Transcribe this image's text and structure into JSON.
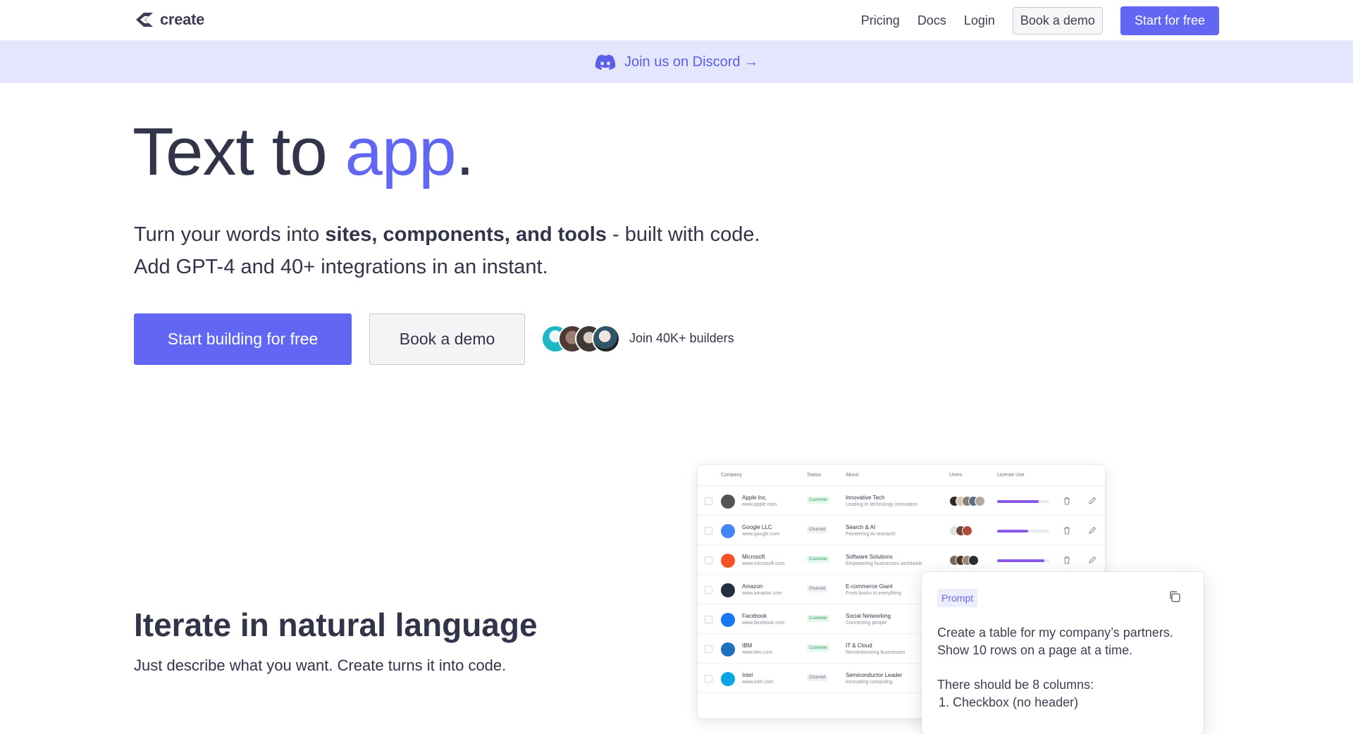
{
  "nav": {
    "logo_text": "create",
    "links": [
      "Pricing",
      "Docs",
      "Login"
    ],
    "book_demo": "Book a demo",
    "start_free": "Start for free"
  },
  "banner": {
    "text": "Join us on Discord →"
  },
  "hero": {
    "title_main": "Text to ",
    "title_accent": "app",
    "title_end": ".",
    "sub_line1_pre": "Turn your words into ",
    "sub_line1_bold": "sites, components, and tools",
    "sub_line1_post": " - built with code.",
    "sub_line2": "Add GPT-4 and 40+ integrations in an instant.",
    "cta_primary": "Start building for free",
    "cta_secondary": "Book a demo",
    "builders_text": "Join 40K+ builders"
  },
  "section2": {
    "title": "Iterate in natural language",
    "subtitle": "Just describe what you want. Create turns it into code."
  },
  "table": {
    "headers": [
      "Company",
      "Status",
      "About",
      "Users",
      "License Use"
    ],
    "rows": [
      {
        "name": "Apple Inc.",
        "url": "www.apple.com",
        "status": "Customer",
        "about": "Innovative Tech",
        "about_sub": "Leading in technology innovation",
        "license": 0.8,
        "logo_color": "#555555"
      },
      {
        "name": "Google LLC",
        "url": "www.google.com",
        "status": "Churned",
        "about": "Search & AI",
        "about_sub": "Pioneering AI research",
        "license": 0.6,
        "logo_color": "#4285f4"
      },
      {
        "name": "Microsoft",
        "url": "www.microsoft.com",
        "status": "Customer",
        "about": "Software Solutions",
        "about_sub": "Empowering businesses worldwide",
        "license": 0.9,
        "logo_color": "#f35325"
      },
      {
        "name": "Amazon",
        "url": "www.amazon.com",
        "status": "Churned",
        "about": "E-commerce Giant",
        "about_sub": "From books to everything",
        "license": 0.0,
        "logo_color": "#232f3e"
      },
      {
        "name": "Facebook",
        "url": "www.facebook.com",
        "status": "Customer",
        "about": "Social Networking",
        "about_sub": "Connecting people",
        "license": 0.0,
        "logo_color": "#1877f2"
      },
      {
        "name": "IBM",
        "url": "www.ibm.com",
        "status": "Customer",
        "about": "IT & Cloud",
        "about_sub": "Revolutionizing businesses",
        "license": 0.0,
        "logo_color": "#1f70c1"
      },
      {
        "name": "Intel",
        "url": "www.intel.com",
        "status": "Churned",
        "about": "Semiconductor Leader",
        "about_sub": "Innovating computing",
        "license": 0.0,
        "logo_color": "#0aa5e5"
      }
    ]
  },
  "prompt": {
    "tag": "Prompt",
    "line1": "Create a table for my company’s partners.",
    "line2": "Show 10 rows on a page at a time.",
    "line3": "There should be 8 columns:",
    "line4": "1. Checkbox (no header)"
  },
  "colors": {
    "accent": "#6267f3",
    "banner_bg": "#e3e6fc",
    "text": "#32344a",
    "license_bar": "#8a58e6"
  }
}
